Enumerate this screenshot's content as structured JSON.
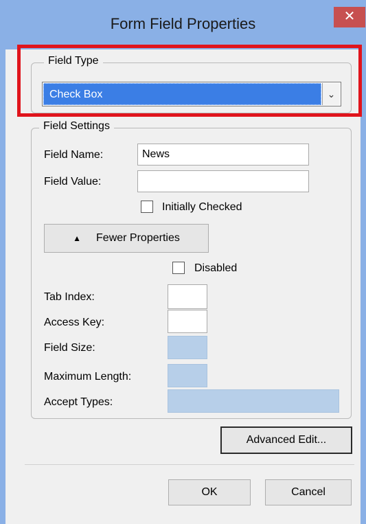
{
  "window": {
    "title": "Form Field Properties",
    "close_glyph": "✕"
  },
  "field_type": {
    "legend": "Field Type",
    "selected": "Check Box",
    "arrow_glyph": "⌄"
  },
  "field_settings": {
    "legend": "Field Settings",
    "field_name_label": "Field Name:",
    "field_name_value": "News",
    "field_value_label": "Field Value:",
    "field_value_value": "",
    "initially_checked_label": "Initially Checked",
    "initially_checked": false,
    "fewer_properties_label": "Fewer Properties",
    "fewer_properties_icon": "▲",
    "disabled_label": "Disabled",
    "disabled": false,
    "tab_index_label": "Tab Index:",
    "tab_index_value": "",
    "access_key_label": "Access Key:",
    "access_key_value": "",
    "field_size_label": "Field Size:",
    "field_size_value": "",
    "max_length_label": "Maximum Length:",
    "max_length_value": "",
    "accept_types_label": "Accept Types:",
    "accept_types_value": ""
  },
  "buttons": {
    "advanced_edit": "Advanced Edit...",
    "ok": "OK",
    "cancel": "Cancel"
  },
  "colors": {
    "titlebar": "#8ab0e6",
    "close": "#c75050",
    "selection": "#3b7ee5",
    "highlight_box": "#e0141c",
    "disabled_input": "#b7cfe9"
  }
}
